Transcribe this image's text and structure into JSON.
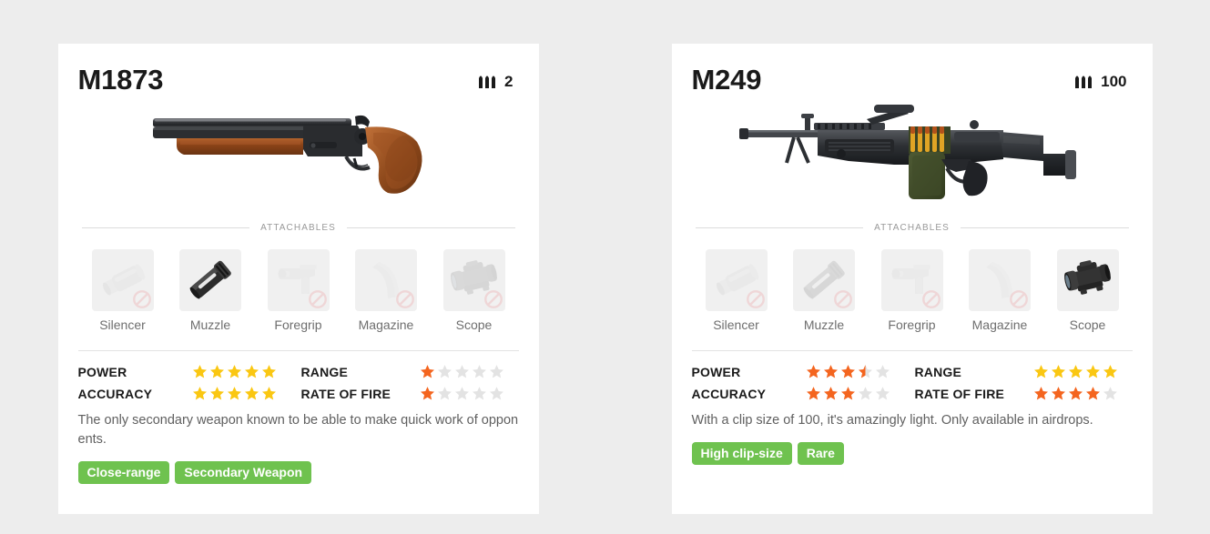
{
  "page": {
    "background_color": "#ededed",
    "card_background": "#ffffff"
  },
  "colors": {
    "star_gold": "#fac712",
    "star_orange": "#f4651f",
    "star_empty": "#e3e3e3",
    "tag_green": "#6fc24f",
    "label_dark": "#1a1a1a",
    "muted_text": "#6e6e6e",
    "no_sign_red": "#e8262b"
  },
  "attachable_labels": [
    "Silencer",
    "Muzzle",
    "Foregrip",
    "Magazine",
    "Scope"
  ],
  "attachables_heading": "ATTACHABLES",
  "stat_labels": {
    "power": "POWER",
    "accuracy": "ACCURACY",
    "range": "RANGE",
    "rate_of_fire": "RATE OF FIRE"
  },
  "cards": [
    {
      "name": "M1873",
      "ammo_icon": "bullets-icon",
      "ammo_count": "2",
      "weapon_image": "sawed-off-double-barrel-shotgun",
      "attachables": [
        {
          "label": "Silencer",
          "icon": "silencer-icon",
          "enabled": false
        },
        {
          "label": "Muzzle",
          "icon": "muzzle-icon",
          "enabled": true
        },
        {
          "label": "Foregrip",
          "icon": "foregrip-icon",
          "enabled": false
        },
        {
          "label": "Magazine",
          "icon": "magazine-icon",
          "enabled": false
        },
        {
          "label": "Scope",
          "icon": "scope-icon",
          "enabled": false
        }
      ],
      "stats": {
        "power": {
          "label": "POWER",
          "value": 5,
          "max": 5,
          "color": "gold"
        },
        "accuracy": {
          "label": "ACCURACY",
          "value": 5,
          "max": 5,
          "color": "gold"
        },
        "range": {
          "label": "RANGE",
          "value": 1,
          "max": 5,
          "color": "orange"
        },
        "rate_of_fire": {
          "label": "RATE OF FIRE",
          "value": 1,
          "max": 5,
          "color": "orange"
        }
      },
      "description": "The only secondary weapon known to be able to make quick work of opponents.",
      "tags": [
        "Close-range",
        "Secondary Weapon"
      ]
    },
    {
      "name": "M249",
      "ammo_icon": "bullets-icon",
      "ammo_count": "100",
      "weapon_image": "light-machine-gun",
      "attachables": [
        {
          "label": "Silencer",
          "icon": "silencer-icon",
          "enabled": false
        },
        {
          "label": "Muzzle",
          "icon": "muzzle-icon",
          "enabled": false
        },
        {
          "label": "Foregrip",
          "icon": "foregrip-icon",
          "enabled": false
        },
        {
          "label": "Magazine",
          "icon": "magazine-icon",
          "enabled": false
        },
        {
          "label": "Scope",
          "icon": "scope-icon",
          "enabled": true
        }
      ],
      "stats": {
        "power": {
          "label": "POWER",
          "value": 3.5,
          "max": 5,
          "color": "orange"
        },
        "accuracy": {
          "label": "ACCURACY",
          "value": 3,
          "max": 5,
          "color": "orange"
        },
        "range": {
          "label": "RANGE",
          "value": 5,
          "max": 5,
          "color": "gold"
        },
        "rate_of_fire": {
          "label": "RATE OF FIRE",
          "value": 4,
          "max": 5,
          "color": "orange"
        }
      },
      "description": "With a clip size of 100, it's amazingly light. Only available in airdrops.",
      "tags": [
        "High clip-size",
        "Rare"
      ]
    }
  ]
}
